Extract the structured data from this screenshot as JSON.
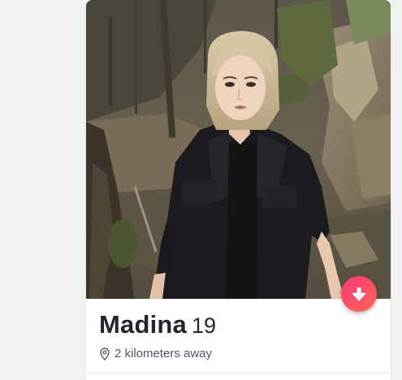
{
  "profile": {
    "name": "Madina",
    "age": "19",
    "distance": "2 kilometers away"
  },
  "icons": {
    "location": "location-pin-icon",
    "more_info": "arrow-down-icon"
  },
  "colors": {
    "name_text": "#21262e",
    "secondary_text": "#505965",
    "accent_start": "#fd3a73",
    "accent_end": "#ff6a4d",
    "page_background": "#f0f2f4"
  }
}
